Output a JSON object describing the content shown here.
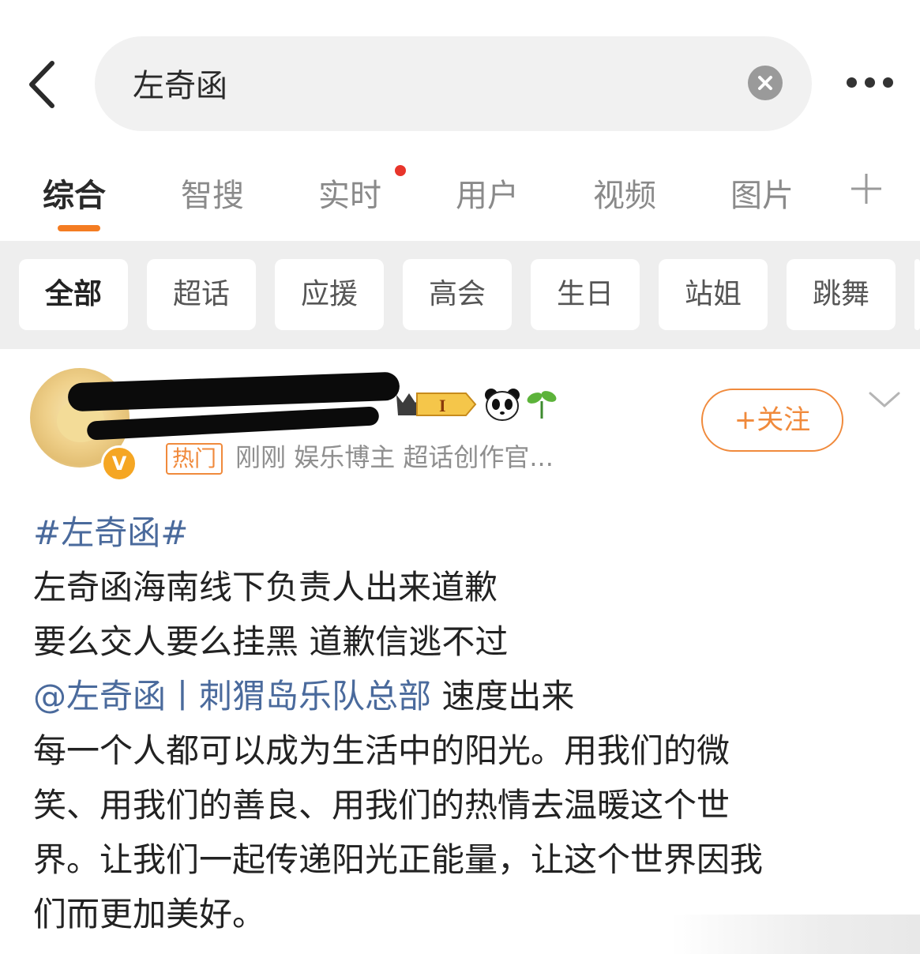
{
  "search": {
    "query": "左奇函"
  },
  "tabs": {
    "items": [
      "综合",
      "智搜",
      "实时",
      "用户",
      "视频",
      "图片"
    ],
    "active_index": 0
  },
  "filters": {
    "items": [
      "全部",
      "超话",
      "应援",
      "高会",
      "生日",
      "站姐",
      "跳舞"
    ],
    "active_index": 0
  },
  "post": {
    "author": {
      "level_badge": "I",
      "meta_badge": "热门",
      "meta_text": "刚刚  娱乐博主 超话创作官..."
    },
    "follow_label": "+关注",
    "hashtag": "#左奇函#",
    "lines": [
      "左奇函海南线下负责人出来道歉",
      "要么交人要么挂黑 道歉信逃不过"
    ],
    "mention": "@左奇函丨刺猬岛乐队总部",
    "mention_tail": " 速度出来",
    "body_lines": [
      "每一个人都可以成为生活中的阳光。用我们的微",
      "笑、用我们的善良、用我们的热情去温暖这个世",
      "界。让我们一起传递阳光正能量，让这个世界因我",
      "们而更加美好。"
    ]
  },
  "colors": {
    "accent": "#f47c22",
    "link": "#4a6a9c",
    "notify_dot": "#e8352b"
  },
  "icons": [
    "back-arrow-icon",
    "clear-icon",
    "more-icon",
    "plus-icon",
    "crown-badge-icon",
    "panda-icon",
    "sprout-icon",
    "chevron-down-icon",
    "verified-icon"
  ]
}
